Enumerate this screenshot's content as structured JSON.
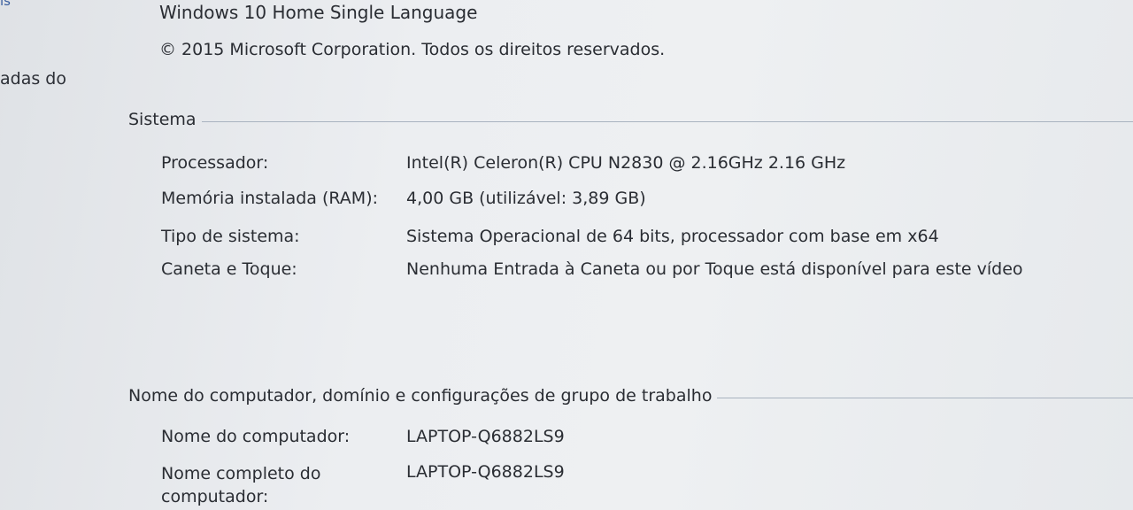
{
  "sidebar": {
    "top_fragment": "is",
    "fragment": "adas do"
  },
  "windows_edition": {
    "edition_name": "Windows 10 Home Single Language",
    "copyright": "© 2015 Microsoft Corporation. Todos os direitos reservados."
  },
  "system": {
    "title": "Sistema",
    "processor_label": "Processador:",
    "processor_value": "Intel(R) Celeron(R) CPU  N2830  @ 2.16GHz   2.16 GHz",
    "ram_label": "Memória instalada (RAM):",
    "ram_value": "4,00 GB (utilizável: 3,89 GB)",
    "system_type_label": "Tipo de sistema:",
    "system_type_value": "Sistema Operacional de 64 bits, processador com base em x64",
    "pen_touch_label": "Caneta e Toque:",
    "pen_touch_value": "Nenhuma Entrada à Caneta ou por Toque está disponível para este vídeo"
  },
  "computer": {
    "title": "Nome do computador, domínio e configurações de grupo de trabalho",
    "name_label": "Nome do computador:",
    "name_value": "LAPTOP-Q6882LS9",
    "full_name_label": "Nome completo do computador:",
    "full_name_value": "LAPTOP-Q6882LS9"
  }
}
